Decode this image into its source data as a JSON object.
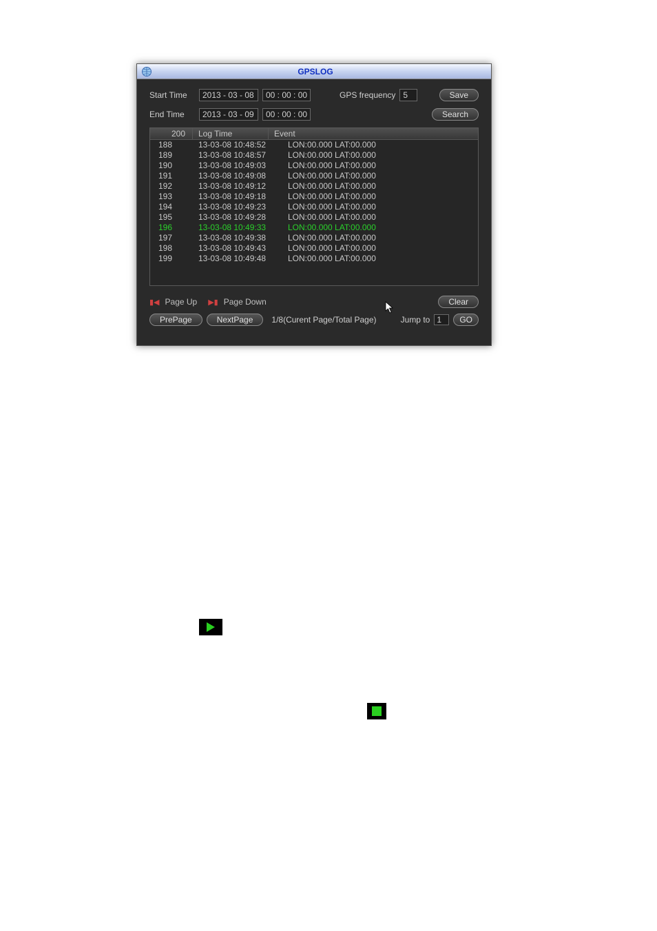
{
  "title": "GPSLOG",
  "form": {
    "start_label": "Start Time",
    "start_date": "2013 - 03 - 08",
    "start_time": "00 : 00 : 00",
    "end_label": "End Time",
    "end_date": "2013 - 03 - 09",
    "end_time": "00 : 00 : 00",
    "freq_label": "GPS frequency",
    "freq_value": "5",
    "save_label": "Save",
    "search_label": "Search"
  },
  "table": {
    "col_idx_header": "200",
    "col_time_header": "Log Time",
    "col_event_header": "Event",
    "rows": [
      {
        "idx": "188",
        "time": "13-03-08 10:48:52",
        "event": "LON:00.000 LAT:00.000",
        "selected": false
      },
      {
        "idx": "189",
        "time": "13-03-08 10:48:57",
        "event": "LON:00.000 LAT:00.000",
        "selected": false
      },
      {
        "idx": "190",
        "time": "13-03-08 10:49:03",
        "event": "LON:00.000 LAT:00.000",
        "selected": false
      },
      {
        "idx": "191",
        "time": "13-03-08 10:49:08",
        "event": "LON:00.000 LAT:00.000",
        "selected": false
      },
      {
        "idx": "192",
        "time": "13-03-08 10:49:12",
        "event": "LON:00.000 LAT:00.000",
        "selected": false
      },
      {
        "idx": "193",
        "time": "13-03-08 10:49:18",
        "event": "LON:00.000 LAT:00.000",
        "selected": false
      },
      {
        "idx": "194",
        "time": "13-03-08 10:49:23",
        "event": "LON:00.000 LAT:00.000",
        "selected": false
      },
      {
        "idx": "195",
        "time": "13-03-08 10:49:28",
        "event": "LON:00.000 LAT:00.000",
        "selected": false
      },
      {
        "idx": "196",
        "time": "13-03-08 10:49:33",
        "event": "LON:00.000 LAT:00.000",
        "selected": true
      },
      {
        "idx": "197",
        "time": "13-03-08 10:49:38",
        "event": "LON:00.000 LAT:00.000",
        "selected": false
      },
      {
        "idx": "198",
        "time": "13-03-08 10:49:43",
        "event": "LON:00.000 LAT:00.000",
        "selected": false
      },
      {
        "idx": "199",
        "time": "13-03-08 10:49:48",
        "event": "LON:00.000 LAT:00.000",
        "selected": false
      }
    ]
  },
  "nav": {
    "page_up": "Page Up",
    "page_down": "Page Down",
    "clear": "Clear",
    "pre_page": "PrePage",
    "next_page": "NextPage",
    "page_info": "1/8(Curent Page/Total Page)",
    "jump_to": "Jump to",
    "jump_value": "1",
    "go": "GO"
  },
  "icons": {
    "globe": "globe-icon",
    "play": "play-icon",
    "stop": "stop-icon"
  }
}
